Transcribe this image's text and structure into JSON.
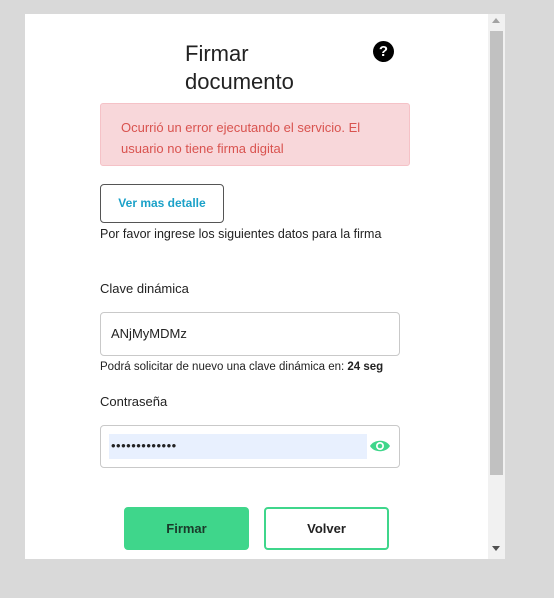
{
  "dialog": {
    "title": "Firmar documento",
    "help_icon": "question-circle-icon",
    "error_message": "Ocurrió un error ejecutando el servicio. El usuario no tiene firma digital",
    "detail_button": "Ver mas detalle",
    "instructions": "Por favor ingrese los siguientes datos para la firma"
  },
  "dynamic_key": {
    "label": "Clave dinámica",
    "value": "ANjMyMDMz",
    "resend_text": "Podrá solicitar de nuevo una clave dinámica en: ",
    "resend_time": "24 seg"
  },
  "password": {
    "label": "Contraseña",
    "masked_value": "•••••••••••••",
    "toggle_icon": "eye-icon"
  },
  "actions": {
    "sign": "Firmar",
    "back": "Volver"
  },
  "colors": {
    "accent": "#3fd68b",
    "error_bg": "#f8d7da",
    "error_text": "#d9534f",
    "link": "#1ba1c8"
  }
}
